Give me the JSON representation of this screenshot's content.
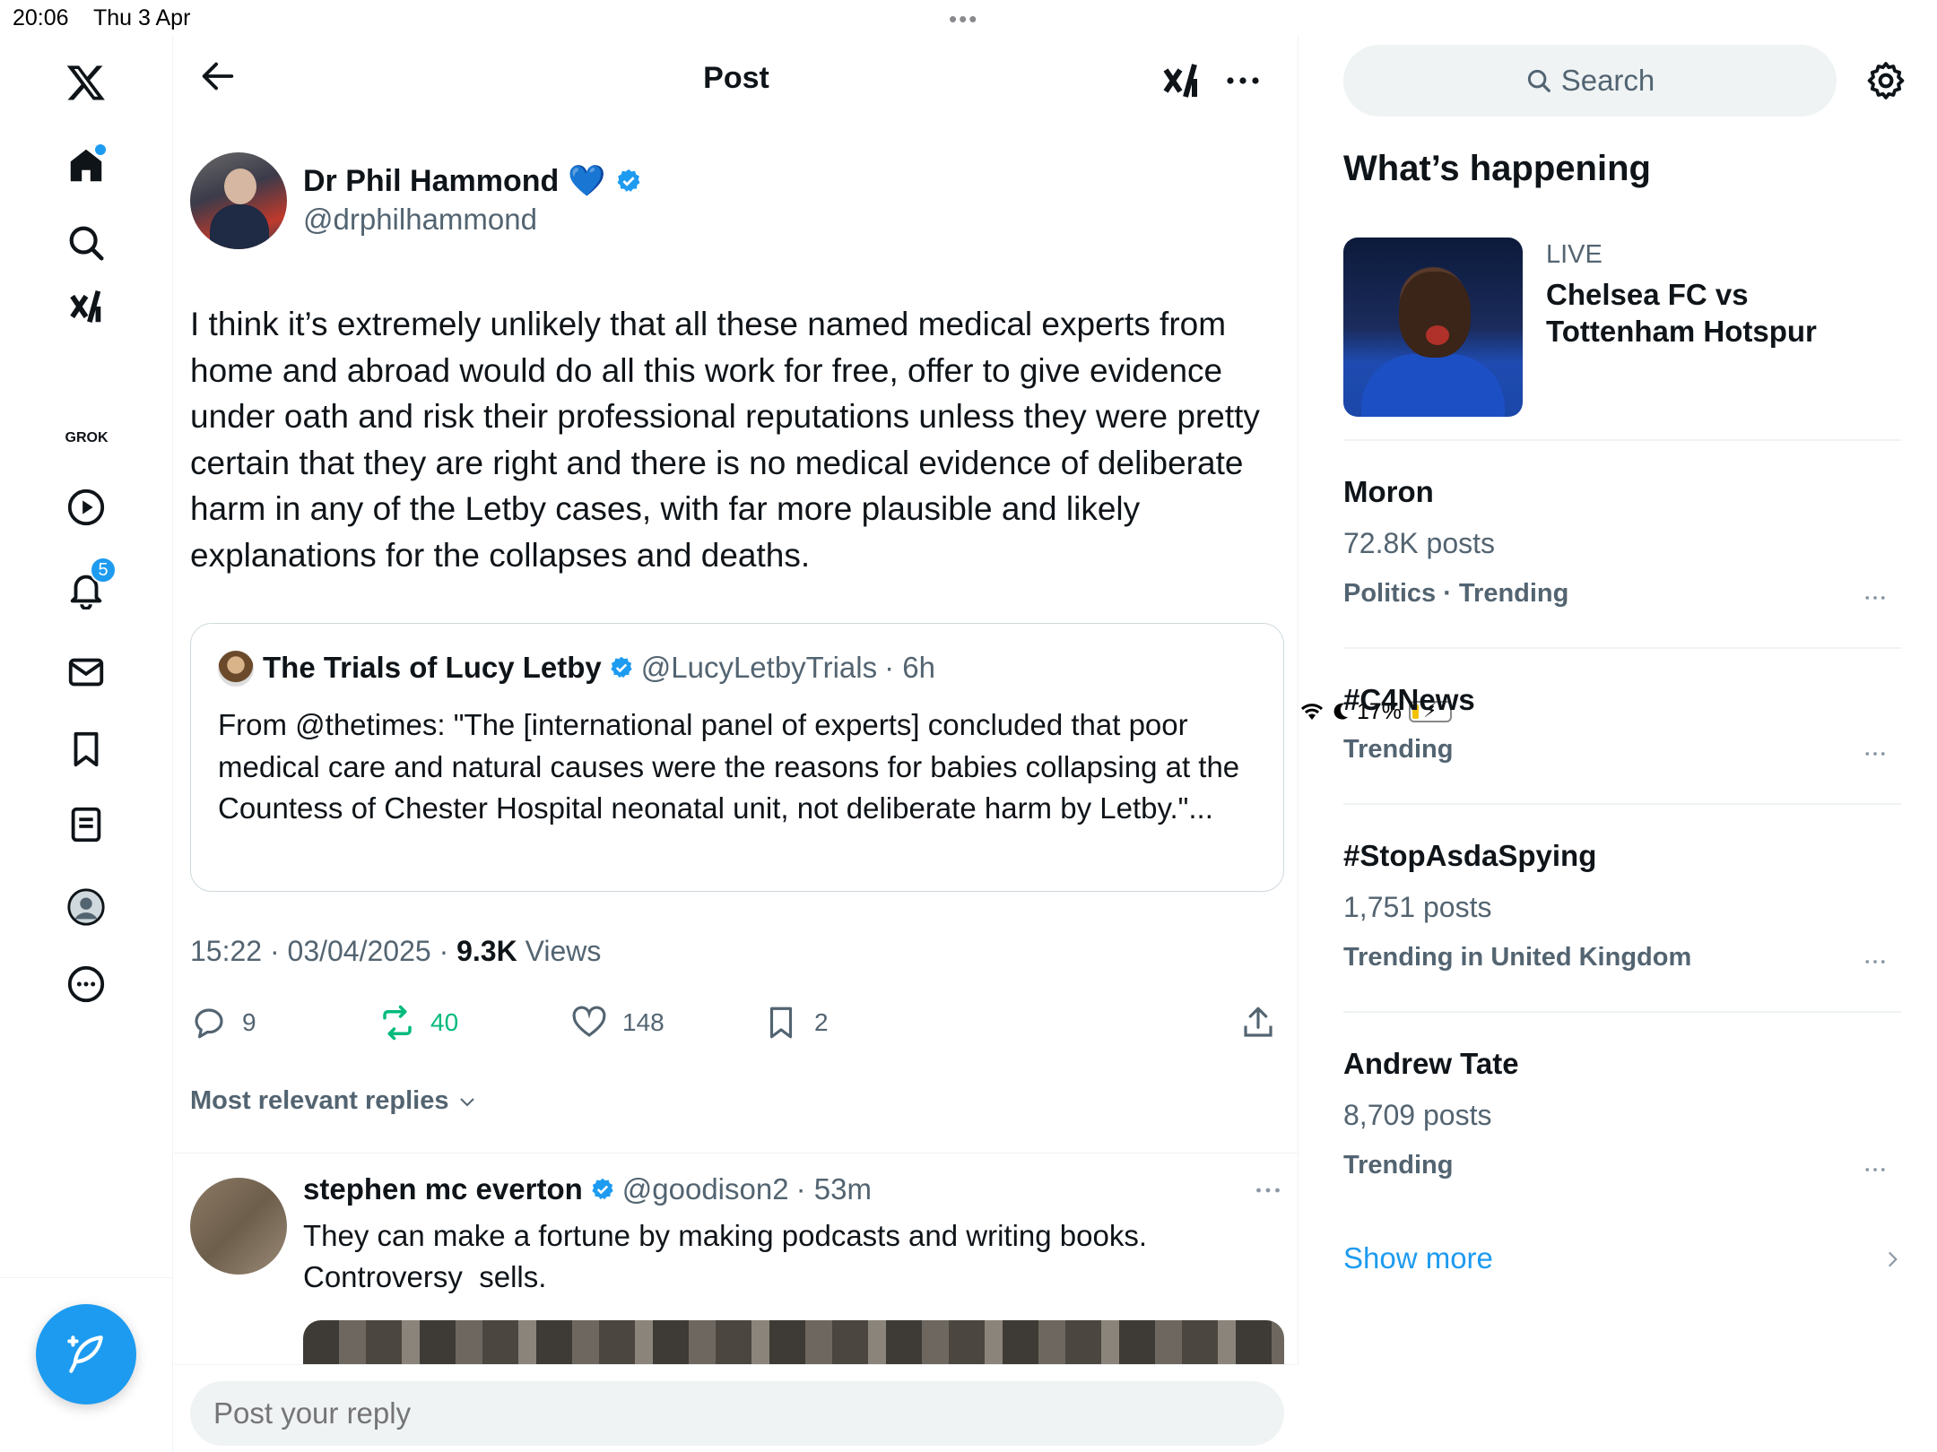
{
  "status": {
    "time": "20:06",
    "date": "Thu 3 Apr",
    "battery": "17%",
    "battery_level": 0.17
  },
  "nav": {
    "grok_label": "GROK",
    "notifications_badge": "5",
    "items": [
      "x-logo",
      "home",
      "explore",
      "grok",
      "video",
      "notifications",
      "messages",
      "bookmarks",
      "lists",
      "profile",
      "more"
    ]
  },
  "header": {
    "title": "Post"
  },
  "post": {
    "author_name": "Dr Phil Hammond",
    "author_emoji": "💙",
    "author_handle": "@drphilhammond",
    "text": "I think it’s extremely unlikely that all these named medical experts from home and abroad would do all this work for free, offer to give evidence under oath and risk their professional reputations unless they were pretty certain that they are right and there is no medical evidence of deliberate harm in any of the Letby cases, with far more plausible and likely explanations for the collapses and deaths.",
    "quote": {
      "name": "The Trials of Lucy Letby",
      "handle": "@LucyLetbyTrials",
      "time": "· 6h",
      "text": "From @thetimes: \"The [international panel of experts] concluded that poor medical care and natural causes were the reasons for babies collapsing at the Countess of Chester Hospital neonatal unit, not deliberate harm by Letby.\"..."
    },
    "timestamp": "15:22 · 03/04/2025 · ",
    "views_count": "9.3K",
    "views_label": " Views",
    "replies": "9",
    "reposts": "40",
    "likes": "148",
    "bookmarks": "2"
  },
  "replies_filter": "Most relevant replies",
  "reply": {
    "name": "stephen mc everton",
    "handle": "@goodison2",
    "time": "· 53m",
    "text_line1": "They can make a fortune by making podcasts and writing books.",
    "text_line2": "Controversy  sells."
  },
  "reply_input": {
    "placeholder": "Post your reply"
  },
  "sidebar": {
    "search_placeholder": "Search",
    "section_title": "What’s happening",
    "live": {
      "label": "LIVE",
      "title": "Chelsea FC vs Tottenham Hotspur"
    },
    "trends": [
      {
        "name": "Moron",
        "count": "72.8K posts",
        "category": "Politics · Trending"
      },
      {
        "name": "#C4News",
        "count": "",
        "category": "Trending"
      },
      {
        "name": "#StopAsdaSpying",
        "count": "1,751 posts",
        "category": "Trending in United Kingdom"
      },
      {
        "name": "Andrew Tate",
        "count": "8,709 posts",
        "category": "Trending"
      }
    ],
    "show_more": "Show more"
  },
  "colors": {
    "accent": "#1d9bf0",
    "repost": "#00ba7c",
    "muted": "#536471",
    "text": "#0f1419"
  }
}
